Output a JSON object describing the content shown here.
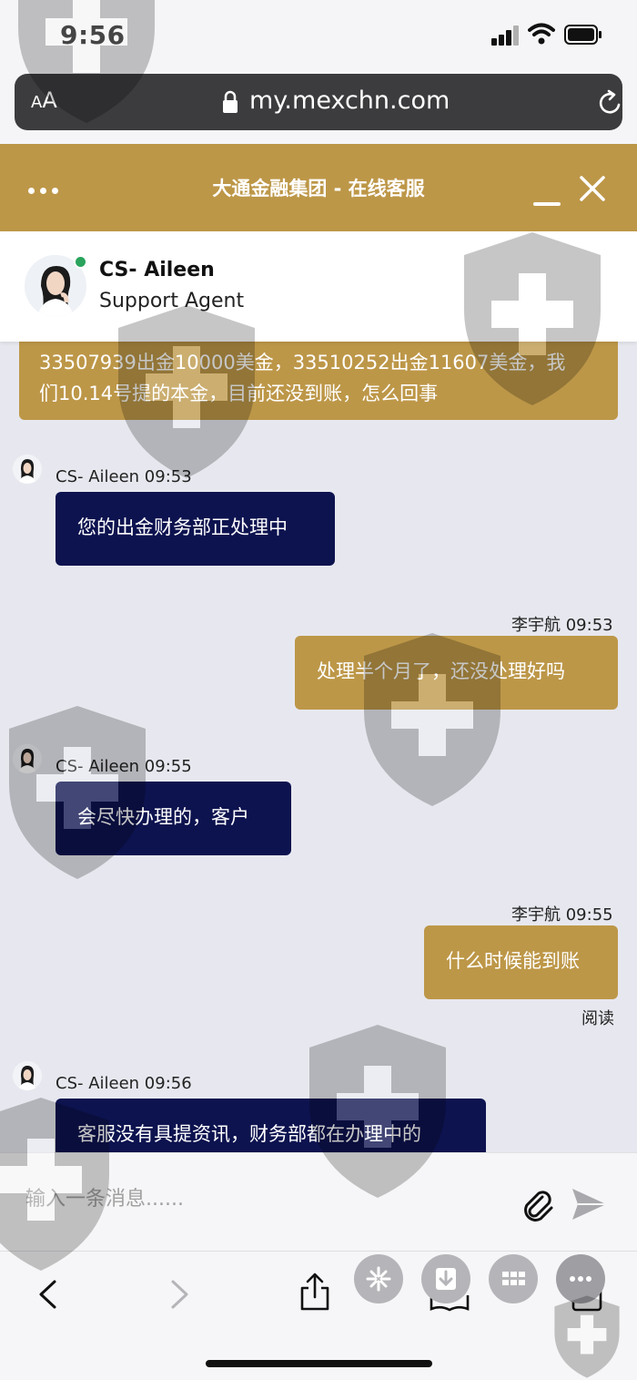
{
  "status_bar": {
    "time": "9:56"
  },
  "browser": {
    "aa_small": "A",
    "aa_large": "A",
    "url": "my.mexchn.com"
  },
  "chat_header": {
    "title": "大通金融集团 - 在线客服"
  },
  "agent": {
    "name": "CS- Aileen",
    "role": "Support Agent",
    "status_color": "#2aa35c"
  },
  "messages": [
    {
      "from": "user",
      "text_line1": "33507939出金10000美金，33510252出金11607美金，我",
      "text_line2": "们10.14号提的本金，目前还没到账，怎么回事"
    },
    {
      "from": "agent",
      "sender": "CS- Aileen 09:53",
      "text": "您的出金财务部正处理中"
    },
    {
      "from": "user",
      "sender": "李宇航 09:53",
      "text": "处理半个月了，还没处理好吗"
    },
    {
      "from": "agent",
      "sender": "CS- Aileen 09:55",
      "text": "会尽快办理的，客户"
    },
    {
      "from": "user",
      "sender": "李宇航 09:55",
      "text": "什么时候能到账",
      "status": "阅读"
    },
    {
      "from": "agent",
      "sender": "CS- Aileen 09:56",
      "text": "客服没有具提资讯，财务部都在办理中的"
    }
  ],
  "composer": {
    "placeholder": "输入一条消息......"
  },
  "icons": {
    "clip": "paperclip-icon",
    "send": "send-icon",
    "back": "chevron-left-icon",
    "forward": "chevron-right-icon",
    "share": "share-icon"
  },
  "colors": {
    "brand_gold": "#bd9748",
    "agent_navy": "#0d134f",
    "chat_bg": "#e7e8ef"
  }
}
